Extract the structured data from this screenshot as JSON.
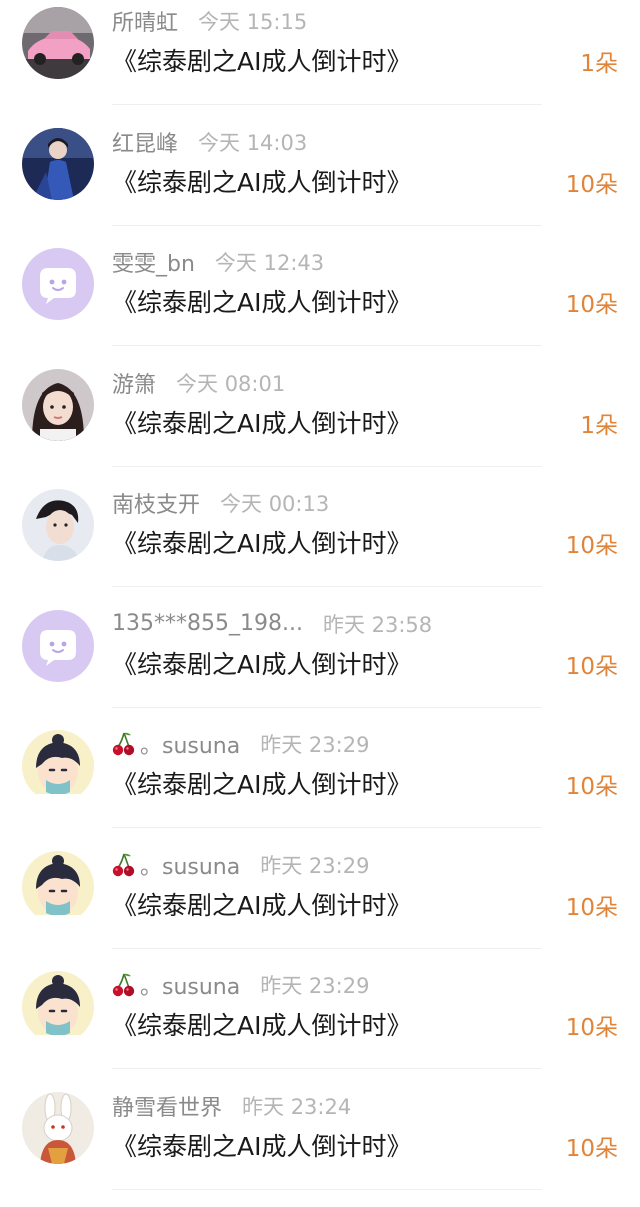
{
  "colors": {
    "name": "#8a8a8a",
    "time": "#b5b5b5",
    "title": "#1a1a1a",
    "amount": "#e0843a",
    "default_avatar_bg": "#d8c9f2"
  },
  "records": [
    {
      "name": "所晴虹",
      "time": "今天 15:15",
      "title": "《综泰剧之AI成人倒计时》",
      "amount": "1朵",
      "avatar": "car-photo-avatar"
    },
    {
      "name": "红昆峰",
      "time": "今天 14:03",
      "title": "《综泰剧之AI成人倒计时》",
      "amount": "10朵",
      "avatar": "blue-dress-photo-avatar"
    },
    {
      "name": "雯雯_bn",
      "time": "今天 12:43",
      "title": "《综泰剧之AI成人倒计时》",
      "amount": "10朵",
      "avatar": "default-chat-bubble-avatar"
    },
    {
      "name": "游箫",
      "time": "今天 08:01",
      "title": "《综泰剧之AI成人倒计时》",
      "amount": "1朵",
      "avatar": "girl-photo-avatar"
    },
    {
      "name": "南枝支开",
      "time": "今天 00:13",
      "title": "《综泰剧之AI成人倒计时》",
      "amount": "10朵",
      "avatar": "man-photo-avatar"
    },
    {
      "name": "135***855_198...",
      "time": "昨天 23:58",
      "title": "《综泰剧之AI成人倒计时》",
      "amount": "10朵",
      "avatar": "default-chat-bubble-avatar"
    },
    {
      "name": "。susuna",
      "time": "昨天 23:29",
      "title": "《综泰剧之AI成人倒计时》",
      "amount": "10朵",
      "avatar": "cartoon-boy-avatar",
      "emoji": "cherry-icon"
    },
    {
      "name": "。susuna",
      "time": "昨天 23:29",
      "title": "《综泰剧之AI成人倒计时》",
      "amount": "10朵",
      "avatar": "cartoon-boy-avatar",
      "emoji": "cherry-icon"
    },
    {
      "name": "。susuna",
      "time": "昨天 23:29",
      "title": "《综泰剧之AI成人倒计时》",
      "amount": "10朵",
      "avatar": "cartoon-boy-avatar",
      "emoji": "cherry-icon"
    },
    {
      "name": "静雪看世界",
      "time": "昨天 23:24",
      "title": "《综泰剧之AI成人倒计时》",
      "amount": "10朵",
      "avatar": "rabbit-avatar"
    }
  ]
}
